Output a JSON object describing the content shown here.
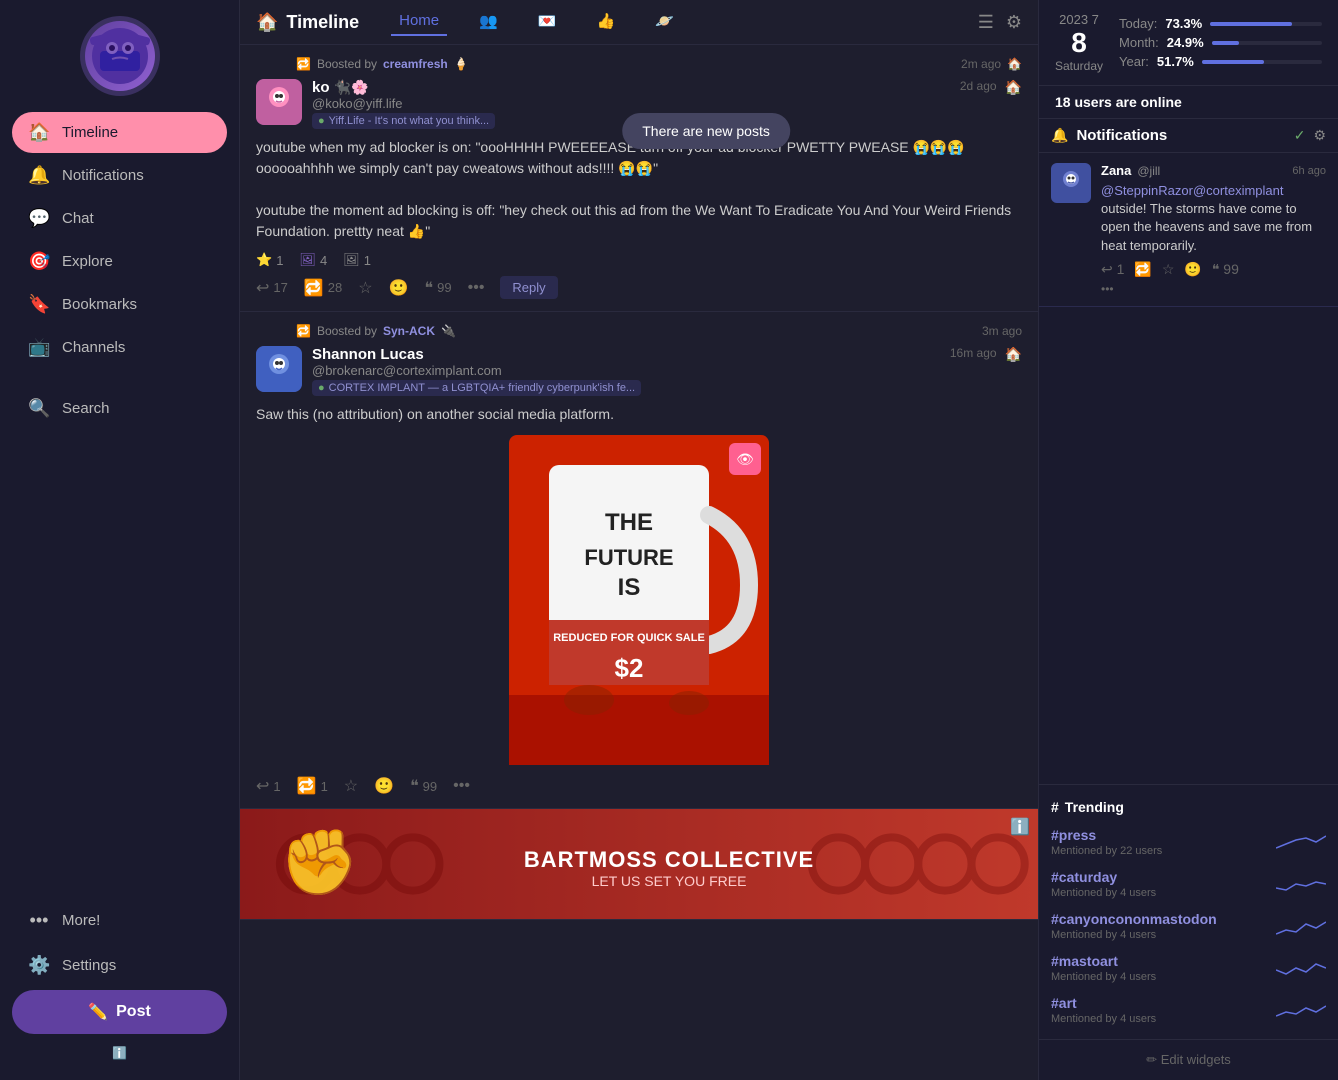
{
  "sidebar": {
    "avatar_emoji": "😤",
    "nav_items": [
      {
        "id": "timeline",
        "label": "Timeline",
        "icon": "🏠",
        "active": true
      },
      {
        "id": "notifications",
        "label": "Notifications",
        "icon": "🔔",
        "active": false
      },
      {
        "id": "chat",
        "label": "Chat",
        "icon": "💬",
        "active": false
      },
      {
        "id": "explore",
        "label": "Explore",
        "icon": "🎯",
        "active": false
      },
      {
        "id": "bookmarks",
        "label": "Bookmarks",
        "icon": "🔖",
        "active": false
      },
      {
        "id": "channels",
        "label": "Channels",
        "icon": "📺",
        "active": false
      },
      {
        "id": "search",
        "label": "Search",
        "icon": "🔍",
        "active": false
      }
    ],
    "more_label": "More!",
    "settings_label": "Settings",
    "post_label": "Post",
    "instance_icon": "ℹ️"
  },
  "header": {
    "title": "Timeline",
    "home_icon": "🏠",
    "home_label": "Home",
    "friends_icon": "👥",
    "dm_icon": "💌",
    "like_icon": "👍",
    "explore_icon": "🪐",
    "list_icon": "☰",
    "gear_icon": "⚙"
  },
  "new_posts_toast": "There are new posts",
  "posts": [
    {
      "id": "post1",
      "boosted_by": "creamfresh",
      "boosted_by_emoji": "🍦",
      "boost_time": "2m ago",
      "author": "ko",
      "author_emojis": "🐈‍⬛🌸",
      "handle": "@koko@yiff.life",
      "instance": "Yiff.Life - It's not what you think...",
      "post_time": "2d ago",
      "home_icon": "🏠",
      "body_lines": [
        "youtube when my ad blocker is on: \"oooHHHH PWEEEEASE turn off your ad blocker PWETTY PWEASE 😭😭😭 oooooahhhh we simply can't pay cweatows without ads!!!! 😭😭\"",
        "",
        "youtube the moment ad blocking is off: \"hey check out this ad from the We Want To Eradicate You And Your Weird Friends Foundation. prettty neat 👍\""
      ],
      "stats": [
        {
          "type": "star",
          "count": "1"
        },
        {
          "type": "boost",
          "count": "4"
        },
        {
          "type": "media",
          "count": "1"
        }
      ],
      "actions": {
        "reply": "17",
        "boost": "28",
        "star": "",
        "emoji": "",
        "quote": "99",
        "more": ""
      },
      "has_reply_btn": true
    },
    {
      "id": "post2",
      "boosted_by": "Syn-ACK",
      "boosted_by_emoji": "🔌",
      "boost_time": "3m ago",
      "author": "Shannon Lucas",
      "author_emojis": "",
      "handle": "@brokenarc@corteximplant.com",
      "instance": "CORTEX IMPLANT — a LGBTQIA+ friendly cyberpunk'ish fe...",
      "post_time": "16m ago",
      "home_icon": "🏠",
      "body_lines": [
        "Saw this (no attribution) on another social media platform."
      ],
      "has_image": true,
      "actions": {
        "reply": "1",
        "boost": "1",
        "star": "",
        "emoji": "",
        "quote": "99",
        "more": ""
      }
    }
  ],
  "banner": {
    "org_name": "BARTMOSS COLLECTIVE",
    "tagline": "LET US SET YOU FREE"
  },
  "right_panel": {
    "date": {
      "year": "2023",
      "day": "8",
      "day_name": "Saturday",
      "day_of_year": "7"
    },
    "stats": [
      {
        "label": "Today:",
        "value": "73.3%",
        "percent": 73.3
      },
      {
        "label": "Month:",
        "value": "24.9%",
        "percent": 24.9
      },
      {
        "label": "Year:",
        "value": "51.7%",
        "percent": 51.7
      }
    ],
    "online_count": "18",
    "online_label": "users are online",
    "notifications": {
      "title": "Notifications",
      "items": [
        {
          "user": "Zana",
          "handle": "@jill",
          "time": "6h ago",
          "mention_user": "@SteppinRazor@corteximplant",
          "text": "outside! The storms have come to open the heavens and save me from heat temporarily.",
          "actions": {
            "reply": "1",
            "boost": "",
            "star": "",
            "emoji": "",
            "quote": "99"
          }
        }
      ]
    },
    "trending": {
      "title": "Trending",
      "items": [
        {
          "tag": "#press",
          "count": "Mentioned by 22 users"
        },
        {
          "tag": "#caturday",
          "count": "Mentioned by 4 users"
        },
        {
          "tag": "#canyoncononmastodon",
          "count": "Mentioned by 4 users"
        },
        {
          "tag": "#mastoart",
          "count": "Mentioned by 4 users"
        },
        {
          "tag": "#art",
          "count": "Mentioned by 4 users"
        }
      ]
    },
    "edit_widgets_label": "Edit widgets"
  }
}
